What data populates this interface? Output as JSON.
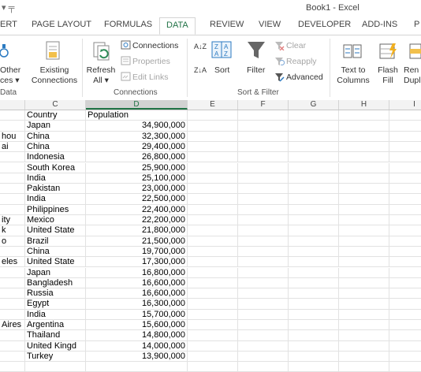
{
  "window": {
    "title": "Book1 - Excel",
    "qa_glyphs": "▾  ╤"
  },
  "tabs": [
    "ERT",
    "PAGE LAYOUT",
    "FORMULAS",
    "DATA",
    "REVIEW",
    "VIEW",
    "DEVELOPER",
    "ADD-INS",
    "P"
  ],
  "ribbon": {
    "get_external": {
      "other_label_1": "Other",
      "other_label_2": "ces ▾",
      "existing_1": "Existing",
      "existing_2": "Connections",
      "group_label": "Data"
    },
    "connections": {
      "refresh_1": "Refresh",
      "refresh_2": "All ▾",
      "connections": "Connections",
      "properties": "Properties",
      "edit_links": "Edit Links",
      "group_label": "Connections"
    },
    "sort_filter": {
      "sort_az": "A↓Z",
      "sort_za": "Z↓A",
      "sort": "Sort",
      "filter": "Filter",
      "clear": "Clear",
      "reapply": "Reapply",
      "advanced": "Advanced",
      "group_label": "Sort & Filter"
    },
    "data_tools": {
      "text_1": "Text to",
      "text_2": "Columns",
      "flash_1": "Flash",
      "flash_2": "Fill",
      "remove_1": "Ren",
      "remove_2": "Dupl"
    }
  },
  "columns": [
    "C",
    "D",
    "E",
    "F",
    "G",
    "H",
    "I"
  ],
  "selected_column": "D",
  "rows": [
    {
      "b": "",
      "c": "Country",
      "d": "Population"
    },
    {
      "b": "",
      "c": "Japan",
      "d": "34,900,000"
    },
    {
      "b": "hou",
      "c": "China",
      "d": "32,300,000"
    },
    {
      "b": "ai",
      "c": "China",
      "d": "29,400,000"
    },
    {
      "b": "",
      "c": "Indonesia",
      "d": "26,800,000"
    },
    {
      "b": "",
      "c": "South Korea",
      "d": "25,900,000"
    },
    {
      "b": "",
      "c": "India",
      "d": "25,100,000"
    },
    {
      "b": "",
      "c": "Pakistan",
      "d": "23,000,000"
    },
    {
      "b": "",
      "c": "India",
      "d": "22,500,000"
    },
    {
      "b": "",
      "c": "Philippines",
      "d": "22,400,000"
    },
    {
      "b": "ity",
      "c": "Mexico",
      "d": "22,200,000"
    },
    {
      "b": "k",
      "c": "United State",
      "d": "21,800,000"
    },
    {
      "b": "o",
      "c": "Brazil",
      "d": "21,500,000"
    },
    {
      "b": "",
      "c": "China",
      "d": "19,700,000"
    },
    {
      "b": "eles",
      "c": "United State",
      "d": "17,300,000"
    },
    {
      "b": "",
      "c": "Japan",
      "d": "16,800,000"
    },
    {
      "b": "",
      "c": "Bangladesh",
      "d": "16,600,000"
    },
    {
      "b": "",
      "c": "Russia",
      "d": "16,600,000"
    },
    {
      "b": "",
      "c": "Egypt",
      "d": "16,300,000"
    },
    {
      "b": "",
      "c": "India",
      "d": "15,700,000"
    },
    {
      "b": "Aires",
      "c": "Argentina",
      "d": "15,600,000"
    },
    {
      "b": "",
      "c": "Thailand",
      "d": "14,800,000"
    },
    {
      "b": "",
      "c": "United Kingd",
      "d": "14,000,000"
    },
    {
      "b": "",
      "c": "Turkey",
      "d": "13,900,000"
    }
  ],
  "colors": {
    "accent": "#217346",
    "group_label": "#555555",
    "disabled": "#a6a6a6"
  }
}
